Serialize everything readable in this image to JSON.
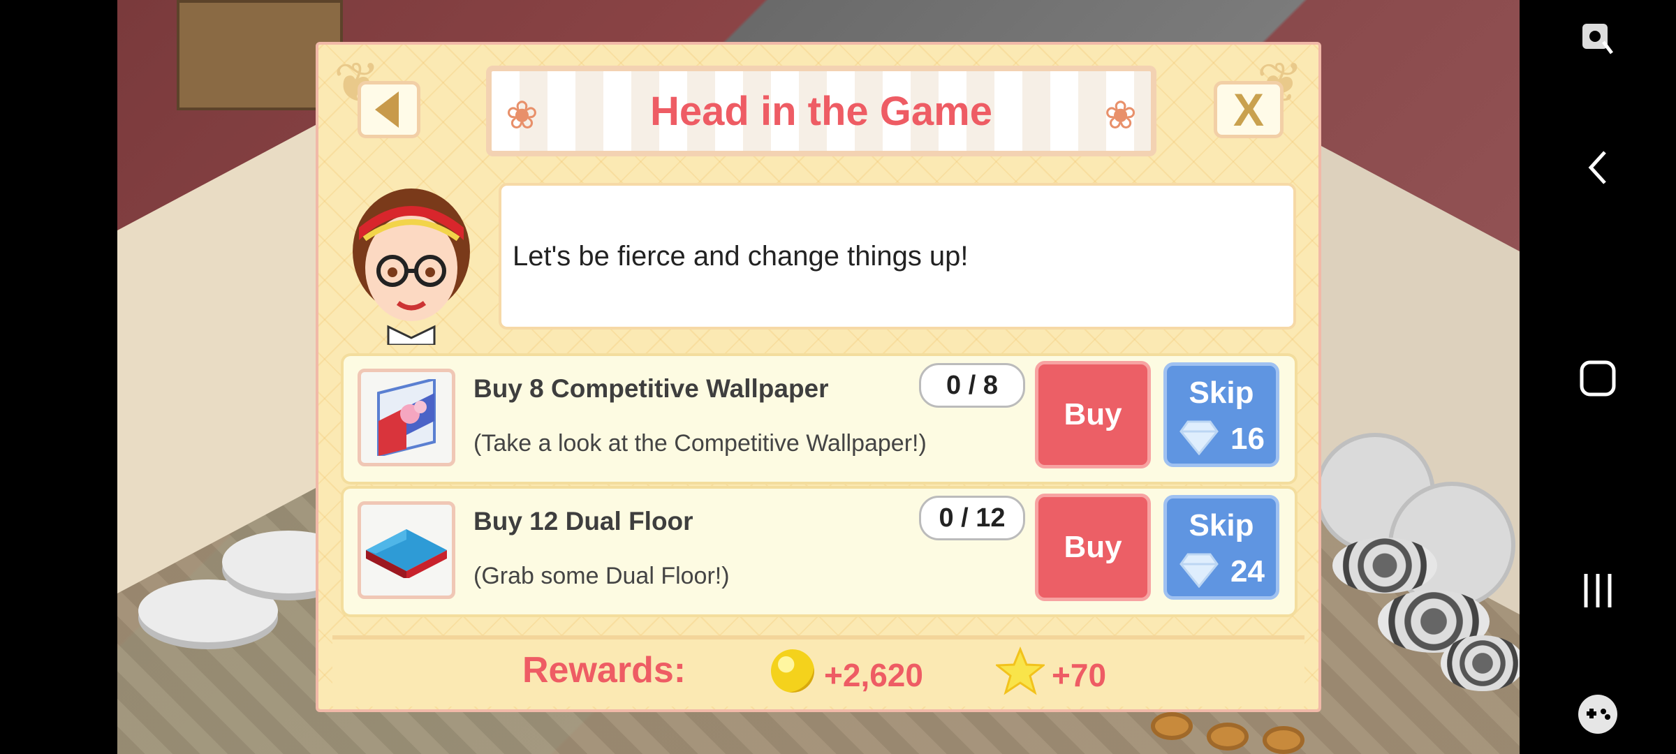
{
  "dialog": {
    "title": "Head in the Game",
    "message": "Let's be fierce and change things up!",
    "back_icon": "back-arrow-icon",
    "close_label": "X"
  },
  "tasks": [
    {
      "title": "Buy 8 Competitive Wallpaper",
      "description": "(Take a look at the Competitive Wallpaper!)",
      "progress": "0 / 8",
      "buy_label": "Buy",
      "skip_label": "Skip",
      "skip_cost": "16",
      "thumb_icon": "wallpaper-icon"
    },
    {
      "title": "Buy 12 Dual Floor",
      "description": "(Grab some Dual Floor!)",
      "progress": "0 / 12",
      "buy_label": "Buy",
      "skip_label": "Skip",
      "skip_cost": "24",
      "thumb_icon": "floor-tile-icon"
    }
  ],
  "rewards": {
    "label": "Rewards:",
    "coins": "+2,620",
    "stars": "+70"
  },
  "colors": {
    "title": "#ee5c64",
    "buy": "#ec5f66",
    "skip": "#5f95e1",
    "dialog_bg": "#fbe9b3"
  },
  "system_nav": {
    "icons": [
      "screen-record-icon",
      "back-icon",
      "home-icon",
      "recents-icon",
      "game-launcher-icon"
    ]
  }
}
